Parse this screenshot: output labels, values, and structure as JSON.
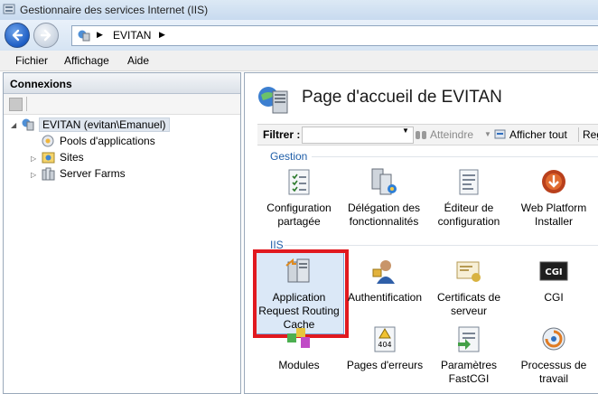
{
  "window": {
    "title": "Gestionnaire des services Internet (IIS)"
  },
  "address": {
    "crumb": "EVITAN"
  },
  "menu": {
    "items": [
      "Fichier",
      "Affichage",
      "Aide"
    ]
  },
  "connections": {
    "header": "Connexions",
    "tree": {
      "root": "EVITAN (evitan\\Emanuel)",
      "children": [
        "Pools d'applications",
        "Sites",
        "Server Farms"
      ]
    }
  },
  "main": {
    "title": "Page d'accueil de EVITAN",
    "filter": {
      "label": "Filtrer :",
      "goto": "Atteindre",
      "show_all": "Afficher tout",
      "group_by": "Reg"
    },
    "groups": [
      {
        "label": "Gestion",
        "features": [
          {
            "label": "Configuration partagée",
            "icon": "shared-config-icon"
          },
          {
            "label": "Délégation des fonctionnalités",
            "icon": "feature-delegation-icon"
          },
          {
            "label": "Éditeur de configuration",
            "icon": "config-editor-icon"
          },
          {
            "label": "Web Platform Installer",
            "icon": "web-platform-installer-icon"
          }
        ]
      },
      {
        "label": "IIS",
        "features": [
          {
            "label": "Application Request Routing Cache",
            "icon": "arr-cache-icon",
            "selected": true
          },
          {
            "label": "Authentification",
            "icon": "authentication-icon"
          },
          {
            "label": "Certificats de serveur",
            "icon": "server-certificates-icon"
          },
          {
            "label": "CGI",
            "icon": "cgi-icon"
          },
          {
            "label": "Modules",
            "icon": "modules-icon"
          },
          {
            "label": "Pages d'erreurs",
            "icon": "error-pages-icon"
          },
          {
            "label": "Paramètres FastCGI",
            "icon": "fastcgi-icon"
          },
          {
            "label": "Processus de travail",
            "icon": "worker-process-icon"
          }
        ]
      }
    ]
  },
  "colors": {
    "highlight": "#e1191f",
    "group_header": "#1f5ea8",
    "selection": "#dbe8f7"
  }
}
